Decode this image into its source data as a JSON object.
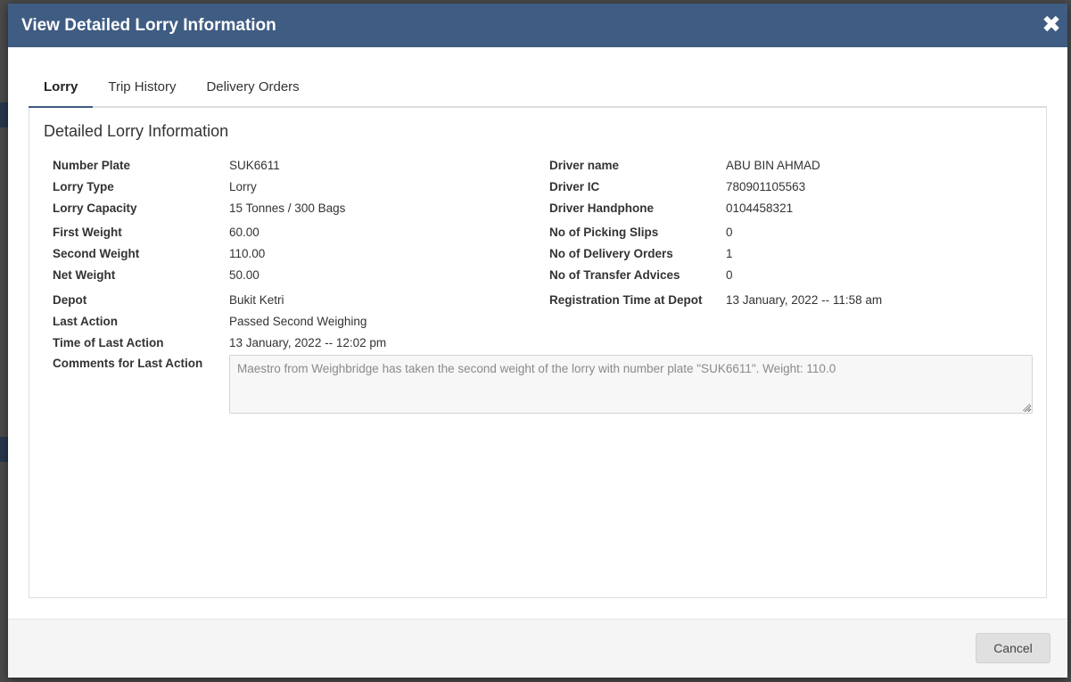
{
  "modal": {
    "title": "View Detailed Lorry Information",
    "close_symbol": "✖",
    "colors": {
      "header": "#3f5c82",
      "tab_active": "#3f5c82"
    }
  },
  "tabs": [
    {
      "label": "Lorry",
      "active": true
    },
    {
      "label": "Trip History",
      "active": false
    },
    {
      "label": "Delivery Orders",
      "active": false
    }
  ],
  "panel": {
    "title": "Detailed Lorry Information",
    "left": [
      {
        "label": "Number Plate",
        "value": "SUK6611"
      },
      {
        "label": "Lorry Type",
        "value": "Lorry"
      },
      {
        "label": "Lorry Capacity",
        "value": "15 Tonnes / 300 Bags"
      },
      {
        "label": "First Weight",
        "value": "60.00"
      },
      {
        "label": "Second Weight",
        "value": "110.00"
      },
      {
        "label": "Net Weight",
        "value": "50.00"
      },
      {
        "label": "Depot",
        "value": "Bukit Ketri"
      },
      {
        "label": "Last Action",
        "value": "Passed Second Weighing"
      },
      {
        "label": "Time of Last Action",
        "value": "13 January, 2022 -- 12:02 pm"
      }
    ],
    "right": [
      {
        "label": "Driver name",
        "value": "ABU BIN AHMAD"
      },
      {
        "label": "Driver IC",
        "value": "780901105563"
      },
      {
        "label": "Driver Handphone",
        "value": "0104458321"
      },
      {
        "label": "No of Picking Slips",
        "value": "0"
      },
      {
        "label": "No of Delivery Orders",
        "value": "1"
      },
      {
        "label": "No of Transfer Advices",
        "value": "0"
      },
      {
        "label": "Registration Time at Depot",
        "value": "13 January, 2022 -- 11:58 am"
      }
    ],
    "comments": {
      "label": "Comments for Last Action",
      "value": "Maestro  from Weighbridge has taken the second weight of the lorry with number plate \"SUK6611\".  Weight: 110.0"
    }
  },
  "footer": {
    "cancel_label": "Cancel"
  }
}
